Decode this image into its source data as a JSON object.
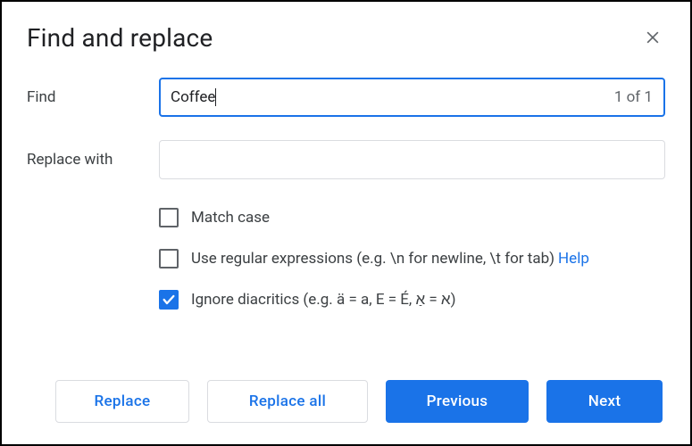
{
  "dialog": {
    "title": "Find and replace"
  },
  "find": {
    "label": "Find",
    "value": "Coffee",
    "match_count": "1 of 1"
  },
  "replace": {
    "label": "Replace with",
    "value": ""
  },
  "options": {
    "match_case": {
      "label": "Match case",
      "checked": false
    },
    "regex": {
      "label": "Use regular expressions (e.g. \\n for newline, \\t for tab)",
      "checked": false,
      "help_label": "Help"
    },
    "diacritics": {
      "label": "Ignore diacritics (e.g. ä = a, E = É, א = אַ)",
      "checked": true
    }
  },
  "buttons": {
    "replace": "Replace",
    "replace_all": "Replace all",
    "previous": "Previous",
    "next": "Next"
  }
}
